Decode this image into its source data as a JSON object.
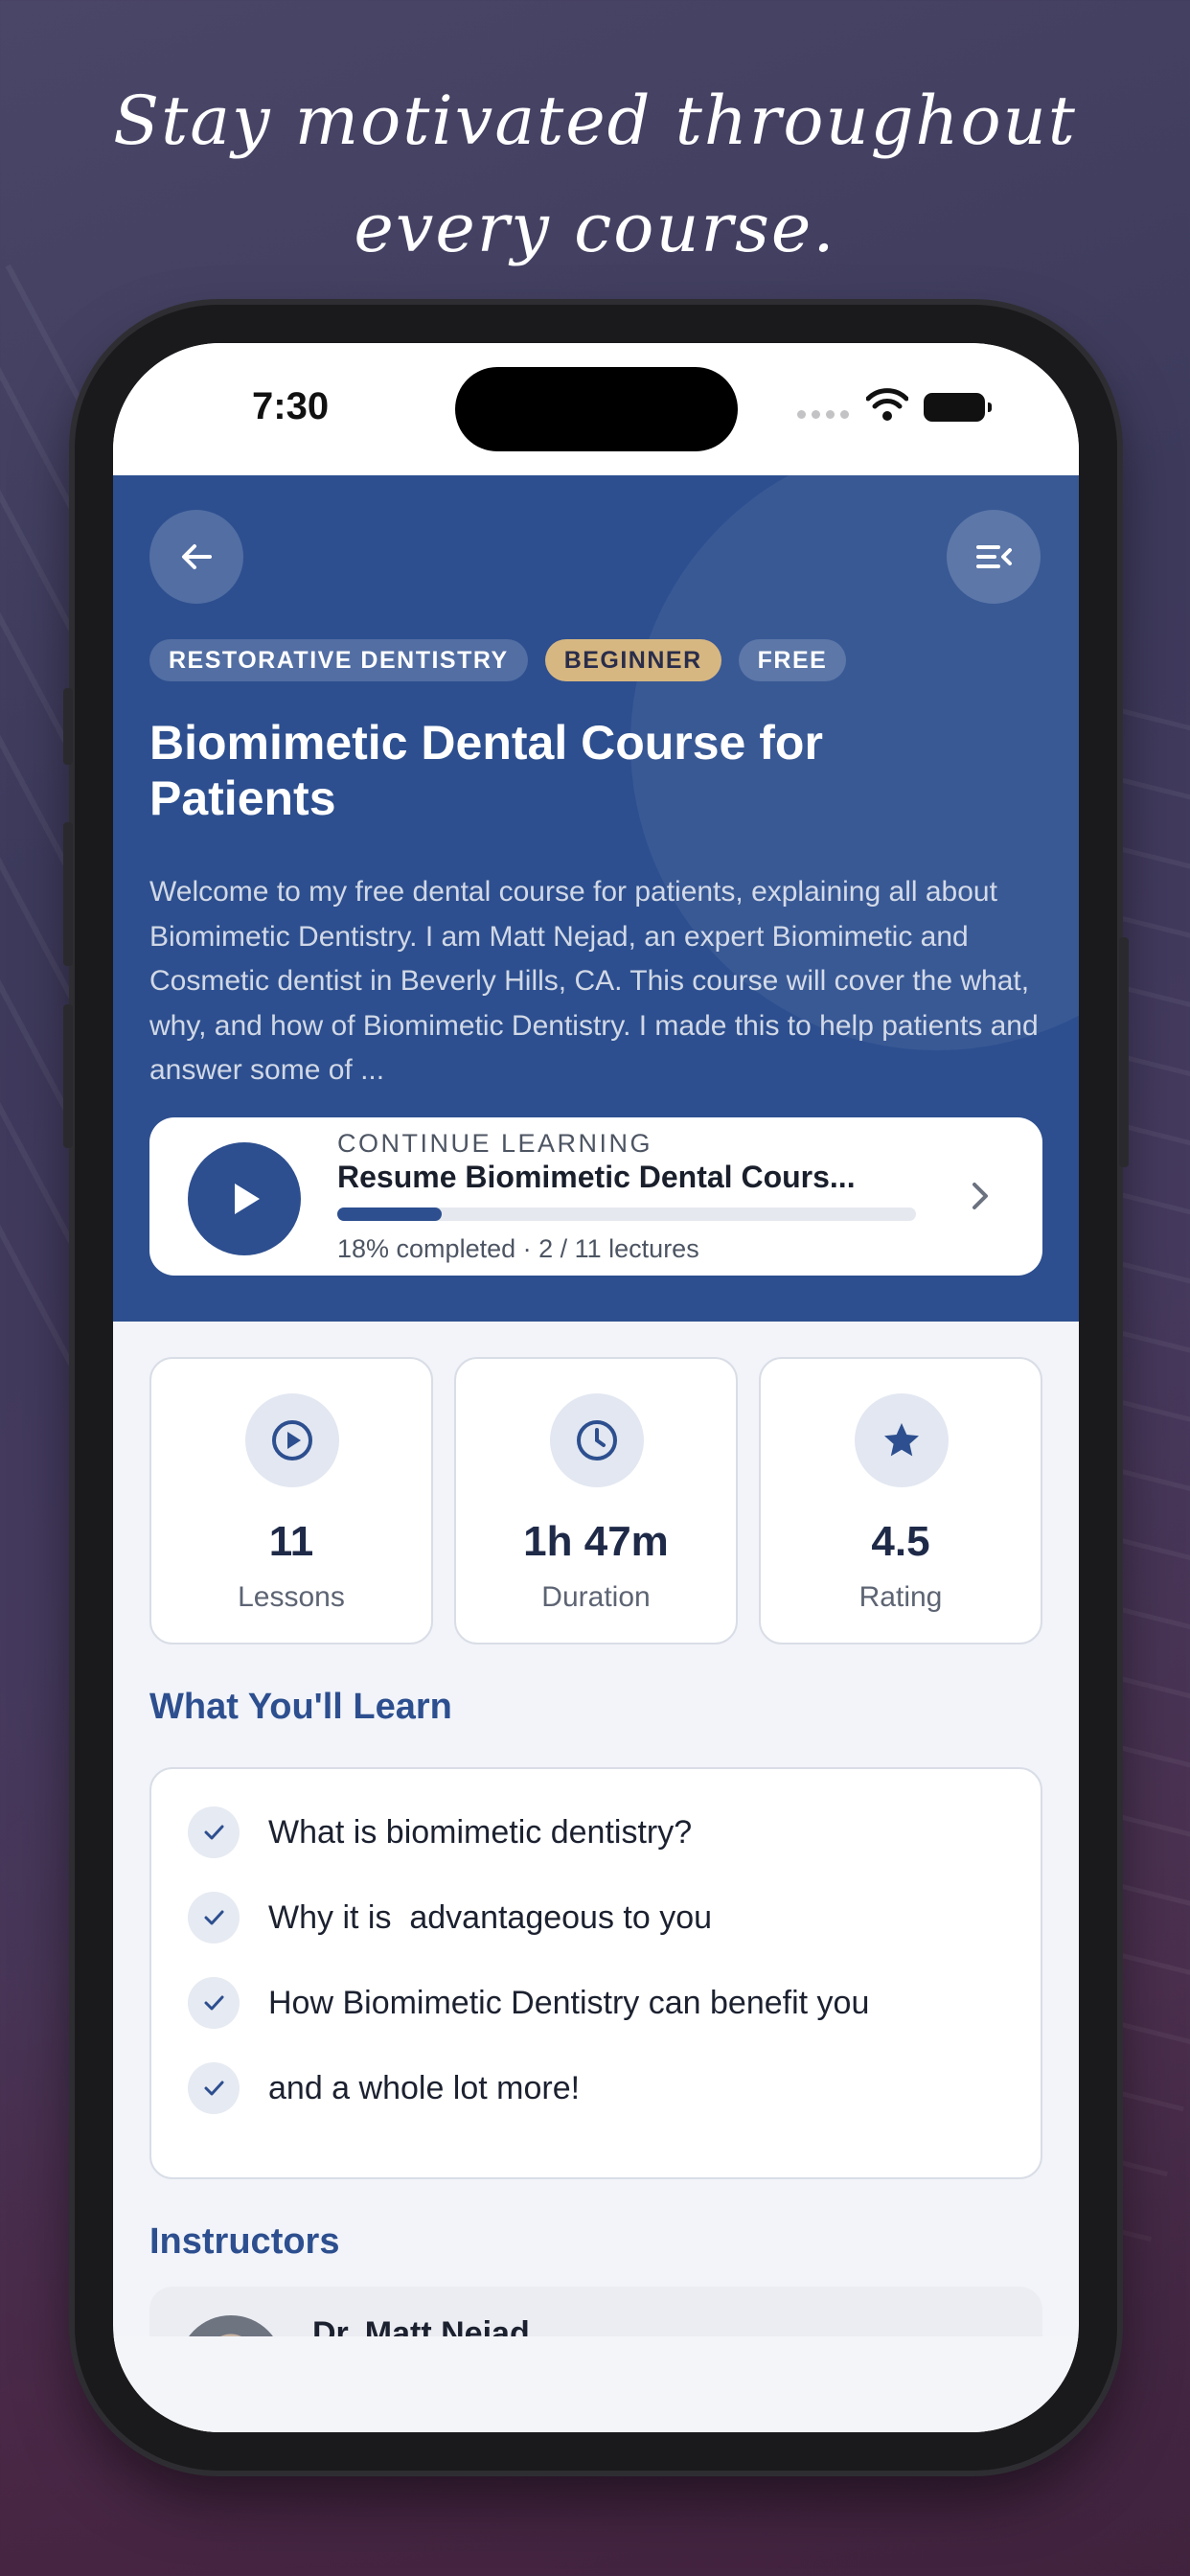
{
  "promo": {
    "headline_line1": "Stay motivated throughout",
    "headline_line2": "every course."
  },
  "status_bar": {
    "time": "7:30"
  },
  "header": {
    "back_icon": "arrow-left-icon",
    "menu_icon": "list-menu-icon"
  },
  "course": {
    "tags": [
      "RESTORATIVE DENTISTRY",
      "BEGINNER",
      "FREE"
    ],
    "title": "Biomimetic Dental Course for Patients",
    "description": "Welcome to my free dental course for patients, explaining all about Biomimetic Dentistry. I am Matt Nejad, an expert Biomimetic and Cosmetic dentist in Beverly Hills, CA. This course will cover the what, why, and how of Biomimetic Dentistry. I made this to help patients and answer some of ..."
  },
  "continue_learning": {
    "label": "CONTINUE LEARNING",
    "title": "Resume Biomimetic Dental Cours...",
    "progress_fraction": 0.18,
    "progress_text": "18% completed · 2 / 11 lectures"
  },
  "stats": [
    {
      "icon": "play-circle-icon",
      "value": "11",
      "label": "Lessons"
    },
    {
      "icon": "clock-icon",
      "value": "1h 47m",
      "label": "Duration"
    },
    {
      "icon": "star-icon",
      "value": "4.5",
      "label": "Rating"
    }
  ],
  "learn": {
    "heading": "What You'll Learn",
    "items": [
      "What is biomimetic dentistry?",
      "Why it is  advantageous to you",
      "How Biomimetic Dentistry can benefit you",
      "and a whole lot more!"
    ]
  },
  "instructors": {
    "heading": "Instructors",
    "list": [
      {
        "name": "Dr. Matt Nejad"
      }
    ]
  },
  "colors": {
    "primary": "#2d4f8f",
    "beginner_badge": "#d7b781",
    "background": "#f2f4f9"
  }
}
